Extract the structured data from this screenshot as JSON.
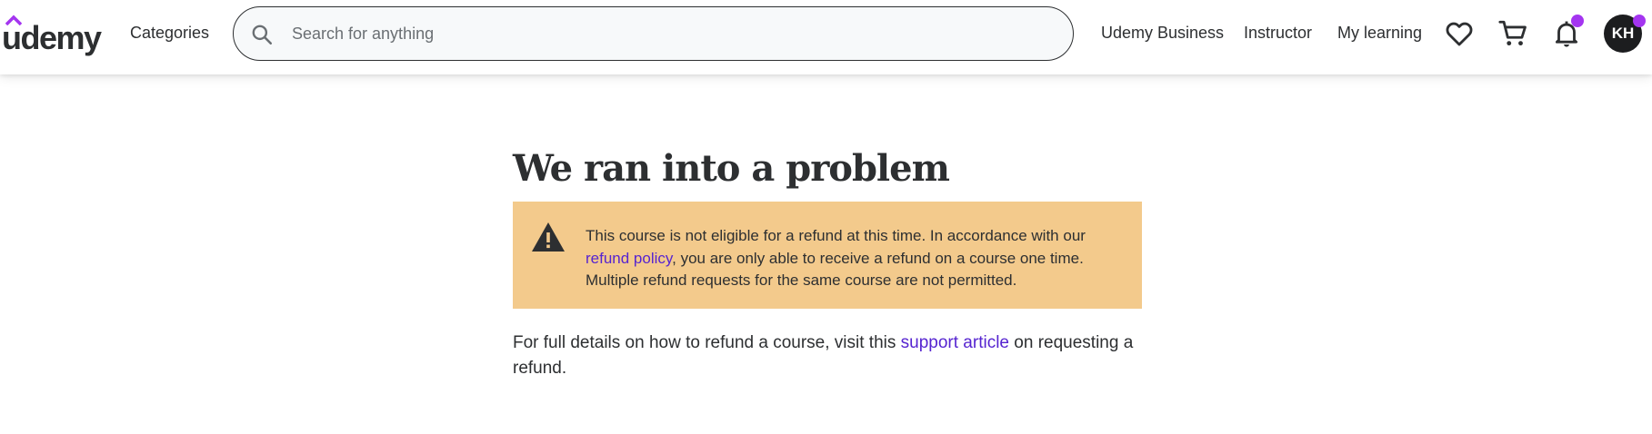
{
  "colors": {
    "brand_purple": "#a435f0",
    "link_purple": "#5624d0",
    "alert_bg": "#f3ca8c",
    "text_dark": "#2d2f31",
    "notification_dot": "#a435f0"
  },
  "header": {
    "logo_text": "udemy",
    "categories_label": "Categories",
    "search": {
      "placeholder": "Search for anything",
      "value": ""
    },
    "nav": {
      "business_label": "Udemy Business",
      "instructor_label": "Instructor",
      "learning_label": "My learning"
    },
    "icons": {
      "wishlist": "heart-icon",
      "cart": "cart-icon",
      "notifications": "bell-icon"
    },
    "avatar_initials": "KH"
  },
  "main": {
    "title": "We ran into a problem",
    "alert": {
      "icon": "warning-icon",
      "text_before_link": "This course is not eligible for a refund at this time. In accordance with our ",
      "link_text": "refund policy",
      "text_after_link": ", you are only able to receive a refund on a course one time. Multiple refund requests for the same course are not permitted."
    },
    "details": {
      "text_before_link": "For full details on how to refund a course, visit this ",
      "link_text": "support article",
      "text_after_link": " on requesting a refund."
    }
  }
}
